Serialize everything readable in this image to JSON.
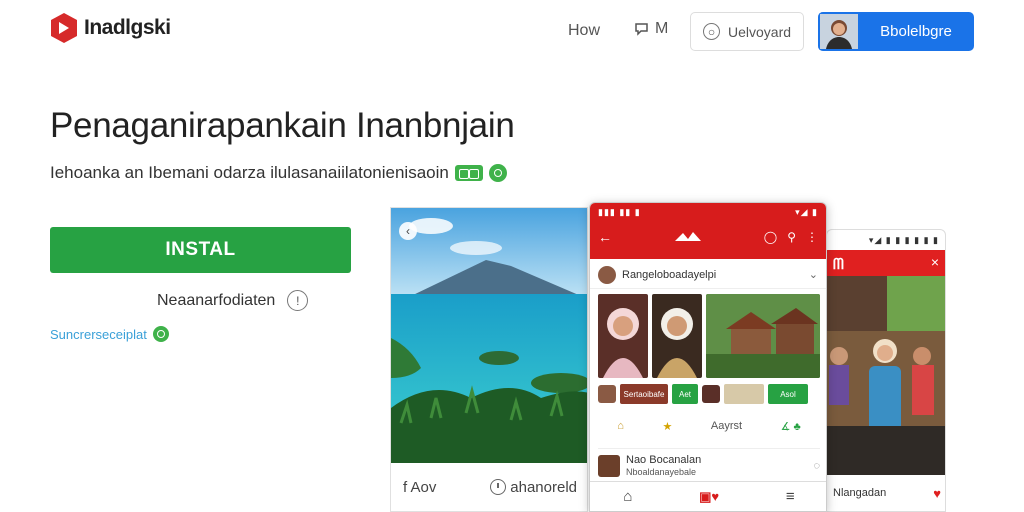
{
  "header": {
    "logo_text": "Inadlgski",
    "nav_how": "How",
    "nav_m": "M",
    "outline_button": "Uelvoyard",
    "profile_button": "Bbolelbgre"
  },
  "hero": {
    "title": "Penaganirapankain Inanbnjain",
    "subtitle": "Iehoanka an Ibemani odarza ilulasanaiilatonienisaoin",
    "install_label": "INSTAL",
    "more_label": "Neaanarfodiaten",
    "support_label": "Suncrerseceiplat"
  },
  "shot1": {
    "back_icon": "back-arrow-icon",
    "foot_left": "f Aov",
    "foot_right": "ahanoreld"
  },
  "shot2": {
    "status_left": "▮▮▮ ▮▮ ▮",
    "status_right": "▾◢ ▮",
    "row1_text": "Rangeloboadayelpi",
    "grid_chip_1": "Sertaoibafe",
    "grid_chip_2": "Aet",
    "grid_chip_3": "Asol",
    "row_icon_label": "Aayrst",
    "row_icon_right": "∡ ♣",
    "item_title": "Nao Bocanalan",
    "item_sub": "Nboaldanayebale"
  },
  "shot3": {
    "status": "▾◢ ▮ ▮ ▮ ▮ ▮ ▮",
    "foot_label": "Nlangadan"
  },
  "colors": {
    "install_green": "#27a243",
    "profile_blue": "#1a73e8",
    "app_red": "#d71c1c",
    "support_blue": "#3aa0d8"
  }
}
